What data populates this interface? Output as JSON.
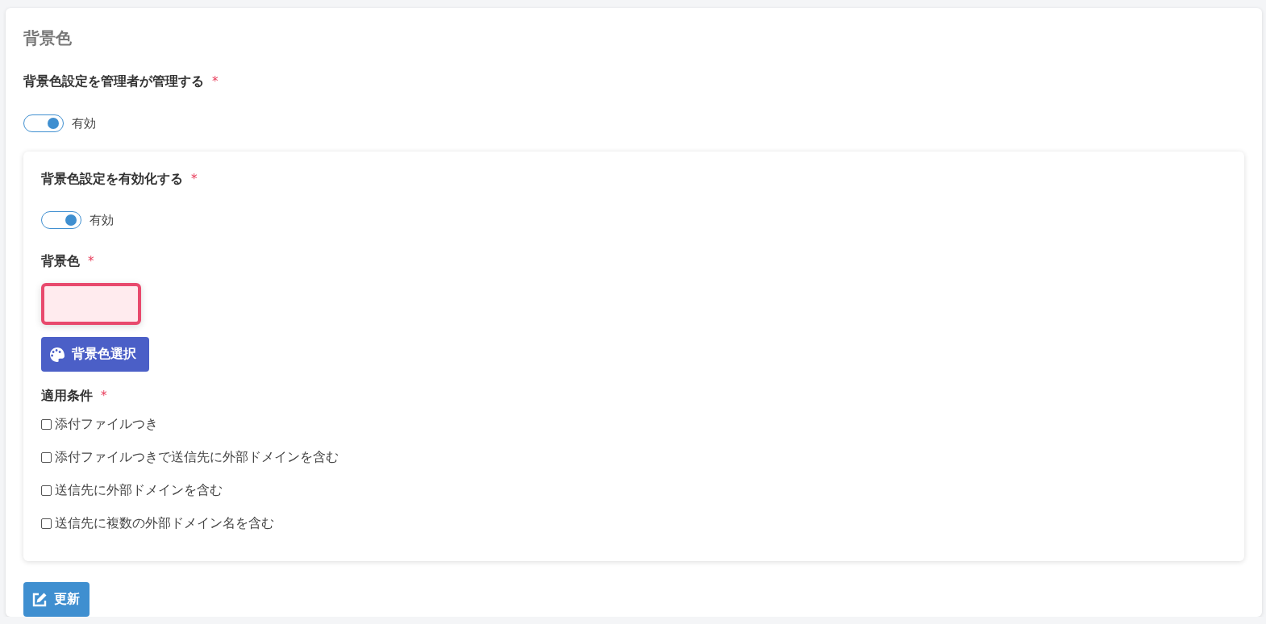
{
  "title": "背景色",
  "admin_setting": {
    "label": "背景色設定を管理者が管理する",
    "required_mark": "*",
    "toggle": {
      "on": true,
      "label": "有効"
    }
  },
  "inner": {
    "enable": {
      "label": "背景色設定を有効化する",
      "required_mark": "*",
      "toggle": {
        "on": true,
        "label": "有効"
      }
    },
    "color": {
      "label": "背景色",
      "required_mark": "*",
      "color": "#ffebee",
      "button": "背景色選択"
    },
    "conditions": {
      "label": "適用条件",
      "required_mark": "*",
      "options": [
        {
          "label": "添付ファイルつき",
          "checked": false
        },
        {
          "label": "添付ファイルつきで送信先に外部ドメインを含む",
          "checked": false
        },
        {
          "label": "送信先に外部ドメインを含む",
          "checked": false
        },
        {
          "label": "送信先に複数の外部ドメイン名を含む",
          "checked": false
        }
      ]
    }
  },
  "update_button": "更新"
}
